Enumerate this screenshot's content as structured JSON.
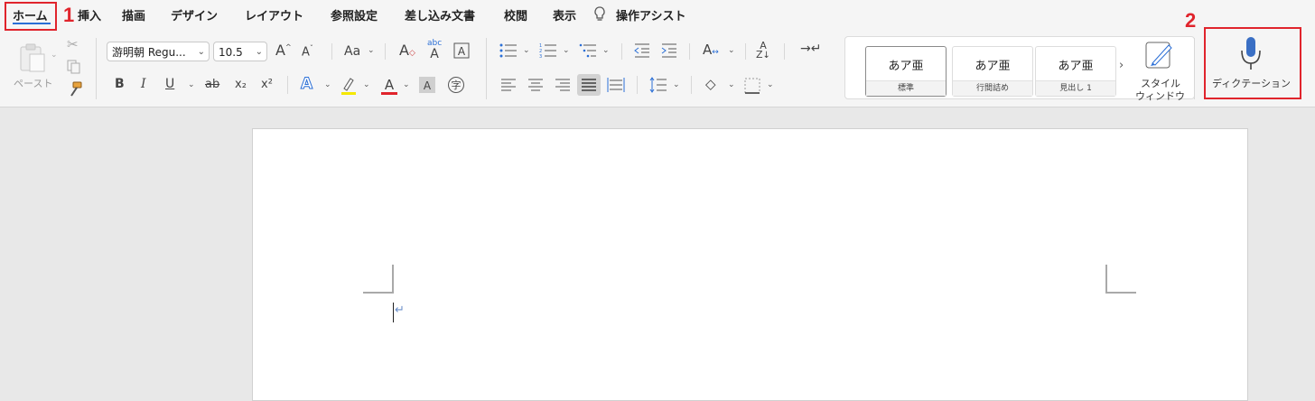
{
  "tabs": [
    "ホーム",
    "挿入",
    "描画",
    "デザイン",
    "レイアウト",
    "参照設定",
    "差し込み文書",
    "校閲",
    "表示",
    "操作アシスト"
  ],
  "callouts": {
    "first": "1",
    "second": "2"
  },
  "clipboard": {
    "paste_label": "ペースト"
  },
  "font": {
    "name": "游明朝 Regu...",
    "size": "10.5"
  },
  "format": {
    "bold": "B",
    "italic": "I",
    "underline": "U",
    "strikethrough": "ab",
    "subscript": "x₂",
    "superscript": "x²",
    "change_case": "Aa"
  },
  "styles": [
    {
      "sample": "あア亜",
      "name": "標準"
    },
    {
      "sample": "あア亜",
      "name": "行間詰め"
    },
    {
      "sample": "あア亜",
      "name": "見出し 1"
    }
  ],
  "style_pane": {
    "line1": "スタイル",
    "line2": "ウィンドウ"
  },
  "dictation": {
    "label": "ディクテーション"
  },
  "colors": {
    "accent_red": "#e0242c",
    "mic_blue": "#3a6fc4",
    "highlight": "#f5e800",
    "font_color": "#e0242c"
  }
}
